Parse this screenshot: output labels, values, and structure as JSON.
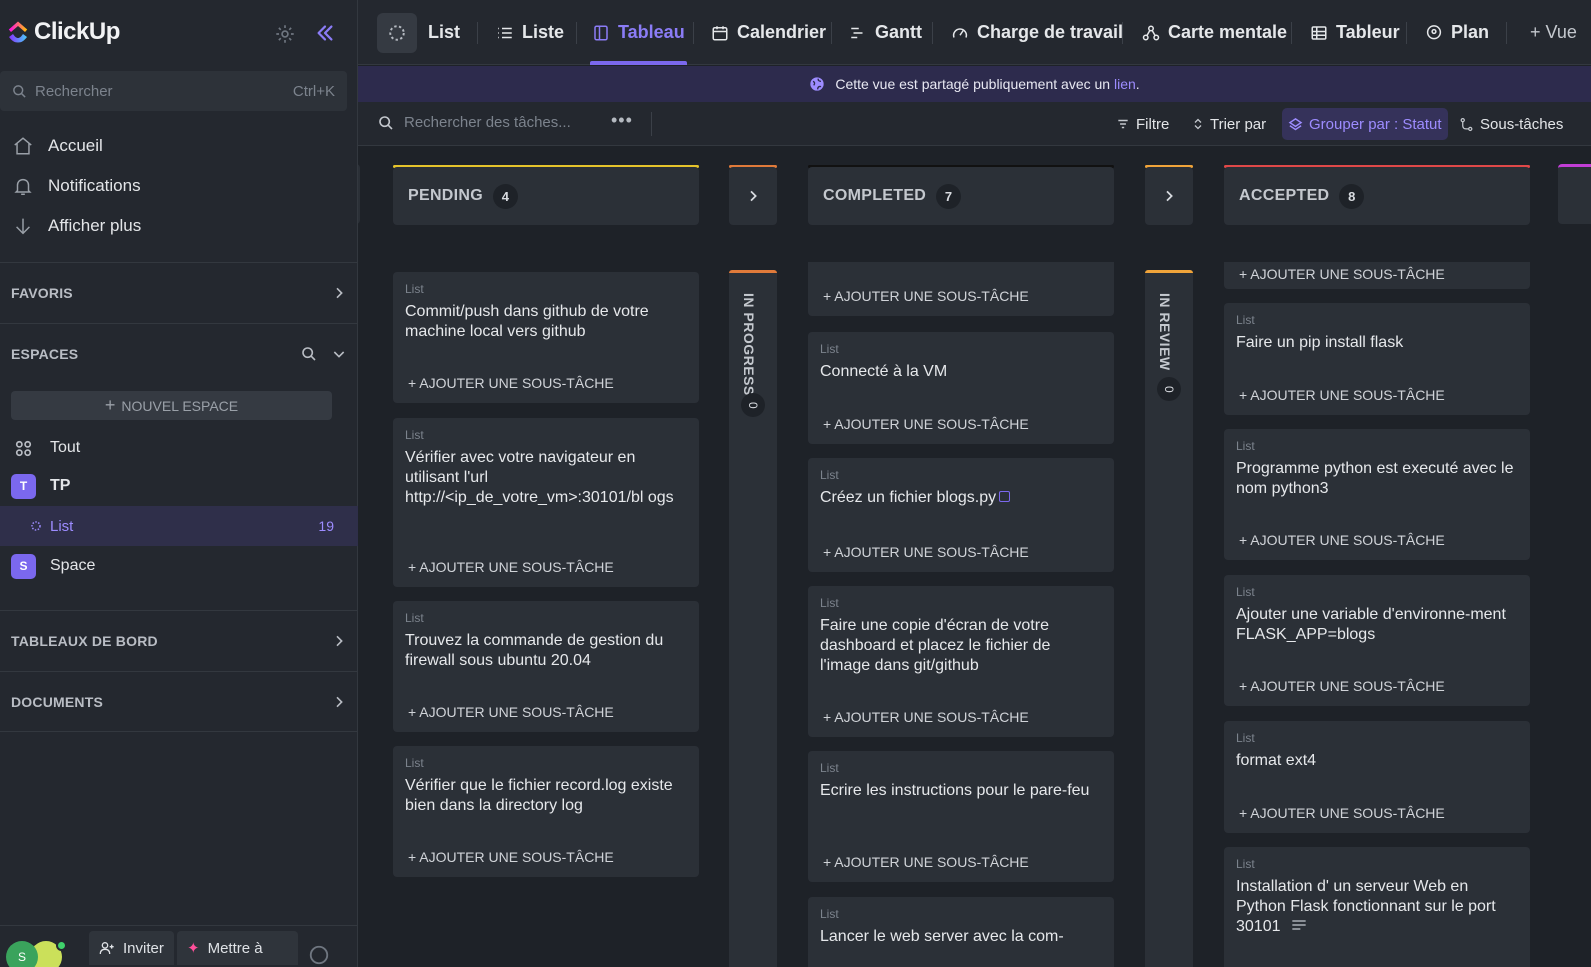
{
  "app": {
    "brand": "ClickUp",
    "search_placeholder": "Rechercher",
    "search_shortcut": "Ctrl+K"
  },
  "sidebar": {
    "nav": [
      {
        "label": "Accueil",
        "icon": "home-icon"
      },
      {
        "label": "Notifications",
        "icon": "bell-icon"
      },
      {
        "label": "Afficher plus",
        "icon": "arrow-down-icon"
      }
    ],
    "favorites": "FAVORIS",
    "spaces_title": "ESPACES",
    "new_space": "NOUVEL ESPACE",
    "spaces": [
      {
        "label": "Tout",
        "icon": "grid-icon"
      },
      {
        "label": "TP",
        "badge": "T"
      },
      {
        "label": "List",
        "count": "19"
      },
      {
        "label": "Space",
        "badge": "S"
      }
    ],
    "dashboards": "TABLEAUX DE BORD",
    "documents": "DOCUMENTS",
    "bottom": {
      "avatar": "S",
      "invite": "Inviter",
      "upgrade": "Mettre à"
    }
  },
  "tabs": [
    {
      "label": "List",
      "icon": "list-spinner-icon"
    },
    {
      "label": "Liste",
      "icon": "list-icon"
    },
    {
      "label": "Tableau",
      "icon": "board-icon",
      "active": true
    },
    {
      "label": "Calendrier",
      "icon": "calendar-icon"
    },
    {
      "label": "Gantt",
      "icon": "gantt-icon"
    },
    {
      "label": "Charge de travail",
      "icon": "gauge-icon"
    },
    {
      "label": "Carte mentale",
      "icon": "mindmap-icon"
    },
    {
      "label": "Tableur",
      "icon": "table-icon"
    },
    {
      "label": "Plan",
      "icon": "map-pin-icon"
    },
    {
      "label": "+ Vue",
      "icon": ""
    }
  ],
  "banner": {
    "text": "Cette vue est partagé publiquement avec un",
    "link": "lien",
    "end": "."
  },
  "toolbar": {
    "search_placeholder": "Rechercher des tâches...",
    "filter": "Filtre",
    "sort": "Trier par",
    "group": "Grouper par : Statut",
    "subtasks": "Sous-tâches"
  },
  "colors": {
    "accent": "#7b68ee",
    "pending": "#e5c32b",
    "in_progress": "#e07a3a",
    "completed": "#111111",
    "in_review": "#f0a43a",
    "accepted": "#e04848"
  },
  "board": {
    "add_subtask": "+ AJOUTER UNE SOUS-TÂCHE",
    "list_label": "List",
    "columns": {
      "pending": {
        "name": "PENDING",
        "count": "4"
      },
      "in_progress": {
        "name": "IN PROGRESS",
        "count": "0"
      },
      "completed": {
        "name": "COMPLETED",
        "count": "7"
      },
      "in_review": {
        "name": "IN REVIEW",
        "count": "0"
      },
      "accepted": {
        "name": "ACCEPTED",
        "count": "8"
      }
    },
    "pending_cards": [
      "Commit/push dans github de votre machine local vers github",
      "Vérifier avec votre navigateur en utilisant l'url http://<ip_de_votre_vm>:30101/bl ogs",
      "Trouvez la commande de gestion du firewall sous ubuntu 20.04",
      "Vérifier que le fichier record.log existe bien dans la directory log"
    ],
    "completed_cards": [
      "Connecté à la VM",
      "Créez un fichier blogs.py",
      "Faire une copie d'écran de votre dashboard et placez le fichier de l'image dans git/github",
      "Ecrire les instructions pour le pare-feu",
      "Lancer le web server avec la com-"
    ],
    "accepted_cards": [
      "Faire un pip install flask",
      "Programme python est executé avec le nom python3",
      "Ajouter une variable d'environne-ment FLASK_APP=blogs",
      "format ext4",
      "Installation d' un serveur Web en Python Flask fonctionnant sur le port 30101"
    ]
  }
}
